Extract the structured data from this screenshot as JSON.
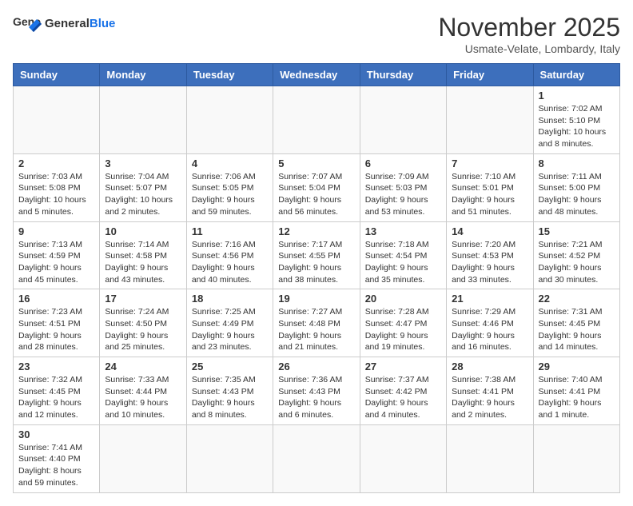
{
  "logo": {
    "text_general": "General",
    "text_blue": "Blue"
  },
  "title": "November 2025",
  "subtitle": "Usmate-Velate, Lombardy, Italy",
  "days_of_week": [
    "Sunday",
    "Monday",
    "Tuesday",
    "Wednesday",
    "Thursday",
    "Friday",
    "Saturday"
  ],
  "weeks": [
    [
      {
        "day": "",
        "info": ""
      },
      {
        "day": "",
        "info": ""
      },
      {
        "day": "",
        "info": ""
      },
      {
        "day": "",
        "info": ""
      },
      {
        "day": "",
        "info": ""
      },
      {
        "day": "",
        "info": ""
      },
      {
        "day": "1",
        "info": "Sunrise: 7:02 AM\nSunset: 5:10 PM\nDaylight: 10 hours and 8 minutes."
      }
    ],
    [
      {
        "day": "2",
        "info": "Sunrise: 7:03 AM\nSunset: 5:08 PM\nDaylight: 10 hours and 5 minutes."
      },
      {
        "day": "3",
        "info": "Sunrise: 7:04 AM\nSunset: 5:07 PM\nDaylight: 10 hours and 2 minutes."
      },
      {
        "day": "4",
        "info": "Sunrise: 7:06 AM\nSunset: 5:05 PM\nDaylight: 9 hours and 59 minutes."
      },
      {
        "day": "5",
        "info": "Sunrise: 7:07 AM\nSunset: 5:04 PM\nDaylight: 9 hours and 56 minutes."
      },
      {
        "day": "6",
        "info": "Sunrise: 7:09 AM\nSunset: 5:03 PM\nDaylight: 9 hours and 53 minutes."
      },
      {
        "day": "7",
        "info": "Sunrise: 7:10 AM\nSunset: 5:01 PM\nDaylight: 9 hours and 51 minutes."
      },
      {
        "day": "8",
        "info": "Sunrise: 7:11 AM\nSunset: 5:00 PM\nDaylight: 9 hours and 48 minutes."
      }
    ],
    [
      {
        "day": "9",
        "info": "Sunrise: 7:13 AM\nSunset: 4:59 PM\nDaylight: 9 hours and 45 minutes."
      },
      {
        "day": "10",
        "info": "Sunrise: 7:14 AM\nSunset: 4:58 PM\nDaylight: 9 hours and 43 minutes."
      },
      {
        "day": "11",
        "info": "Sunrise: 7:16 AM\nSunset: 4:56 PM\nDaylight: 9 hours and 40 minutes."
      },
      {
        "day": "12",
        "info": "Sunrise: 7:17 AM\nSunset: 4:55 PM\nDaylight: 9 hours and 38 minutes."
      },
      {
        "day": "13",
        "info": "Sunrise: 7:18 AM\nSunset: 4:54 PM\nDaylight: 9 hours and 35 minutes."
      },
      {
        "day": "14",
        "info": "Sunrise: 7:20 AM\nSunset: 4:53 PM\nDaylight: 9 hours and 33 minutes."
      },
      {
        "day": "15",
        "info": "Sunrise: 7:21 AM\nSunset: 4:52 PM\nDaylight: 9 hours and 30 minutes."
      }
    ],
    [
      {
        "day": "16",
        "info": "Sunrise: 7:23 AM\nSunset: 4:51 PM\nDaylight: 9 hours and 28 minutes."
      },
      {
        "day": "17",
        "info": "Sunrise: 7:24 AM\nSunset: 4:50 PM\nDaylight: 9 hours and 25 minutes."
      },
      {
        "day": "18",
        "info": "Sunrise: 7:25 AM\nSunset: 4:49 PM\nDaylight: 9 hours and 23 minutes."
      },
      {
        "day": "19",
        "info": "Sunrise: 7:27 AM\nSunset: 4:48 PM\nDaylight: 9 hours and 21 minutes."
      },
      {
        "day": "20",
        "info": "Sunrise: 7:28 AM\nSunset: 4:47 PM\nDaylight: 9 hours and 19 minutes."
      },
      {
        "day": "21",
        "info": "Sunrise: 7:29 AM\nSunset: 4:46 PM\nDaylight: 9 hours and 16 minutes."
      },
      {
        "day": "22",
        "info": "Sunrise: 7:31 AM\nSunset: 4:45 PM\nDaylight: 9 hours and 14 minutes."
      }
    ],
    [
      {
        "day": "23",
        "info": "Sunrise: 7:32 AM\nSunset: 4:45 PM\nDaylight: 9 hours and 12 minutes."
      },
      {
        "day": "24",
        "info": "Sunrise: 7:33 AM\nSunset: 4:44 PM\nDaylight: 9 hours and 10 minutes."
      },
      {
        "day": "25",
        "info": "Sunrise: 7:35 AM\nSunset: 4:43 PM\nDaylight: 9 hours and 8 minutes."
      },
      {
        "day": "26",
        "info": "Sunrise: 7:36 AM\nSunset: 4:43 PM\nDaylight: 9 hours and 6 minutes."
      },
      {
        "day": "27",
        "info": "Sunrise: 7:37 AM\nSunset: 4:42 PM\nDaylight: 9 hours and 4 minutes."
      },
      {
        "day": "28",
        "info": "Sunrise: 7:38 AM\nSunset: 4:41 PM\nDaylight: 9 hours and 2 minutes."
      },
      {
        "day": "29",
        "info": "Sunrise: 7:40 AM\nSunset: 4:41 PM\nDaylight: 9 hours and 1 minute."
      }
    ],
    [
      {
        "day": "30",
        "info": "Sunrise: 7:41 AM\nSunset: 4:40 PM\nDaylight: 8 hours and 59 minutes."
      },
      {
        "day": "",
        "info": ""
      },
      {
        "day": "",
        "info": ""
      },
      {
        "day": "",
        "info": ""
      },
      {
        "day": "",
        "info": ""
      },
      {
        "day": "",
        "info": ""
      },
      {
        "day": "",
        "info": ""
      }
    ]
  ]
}
